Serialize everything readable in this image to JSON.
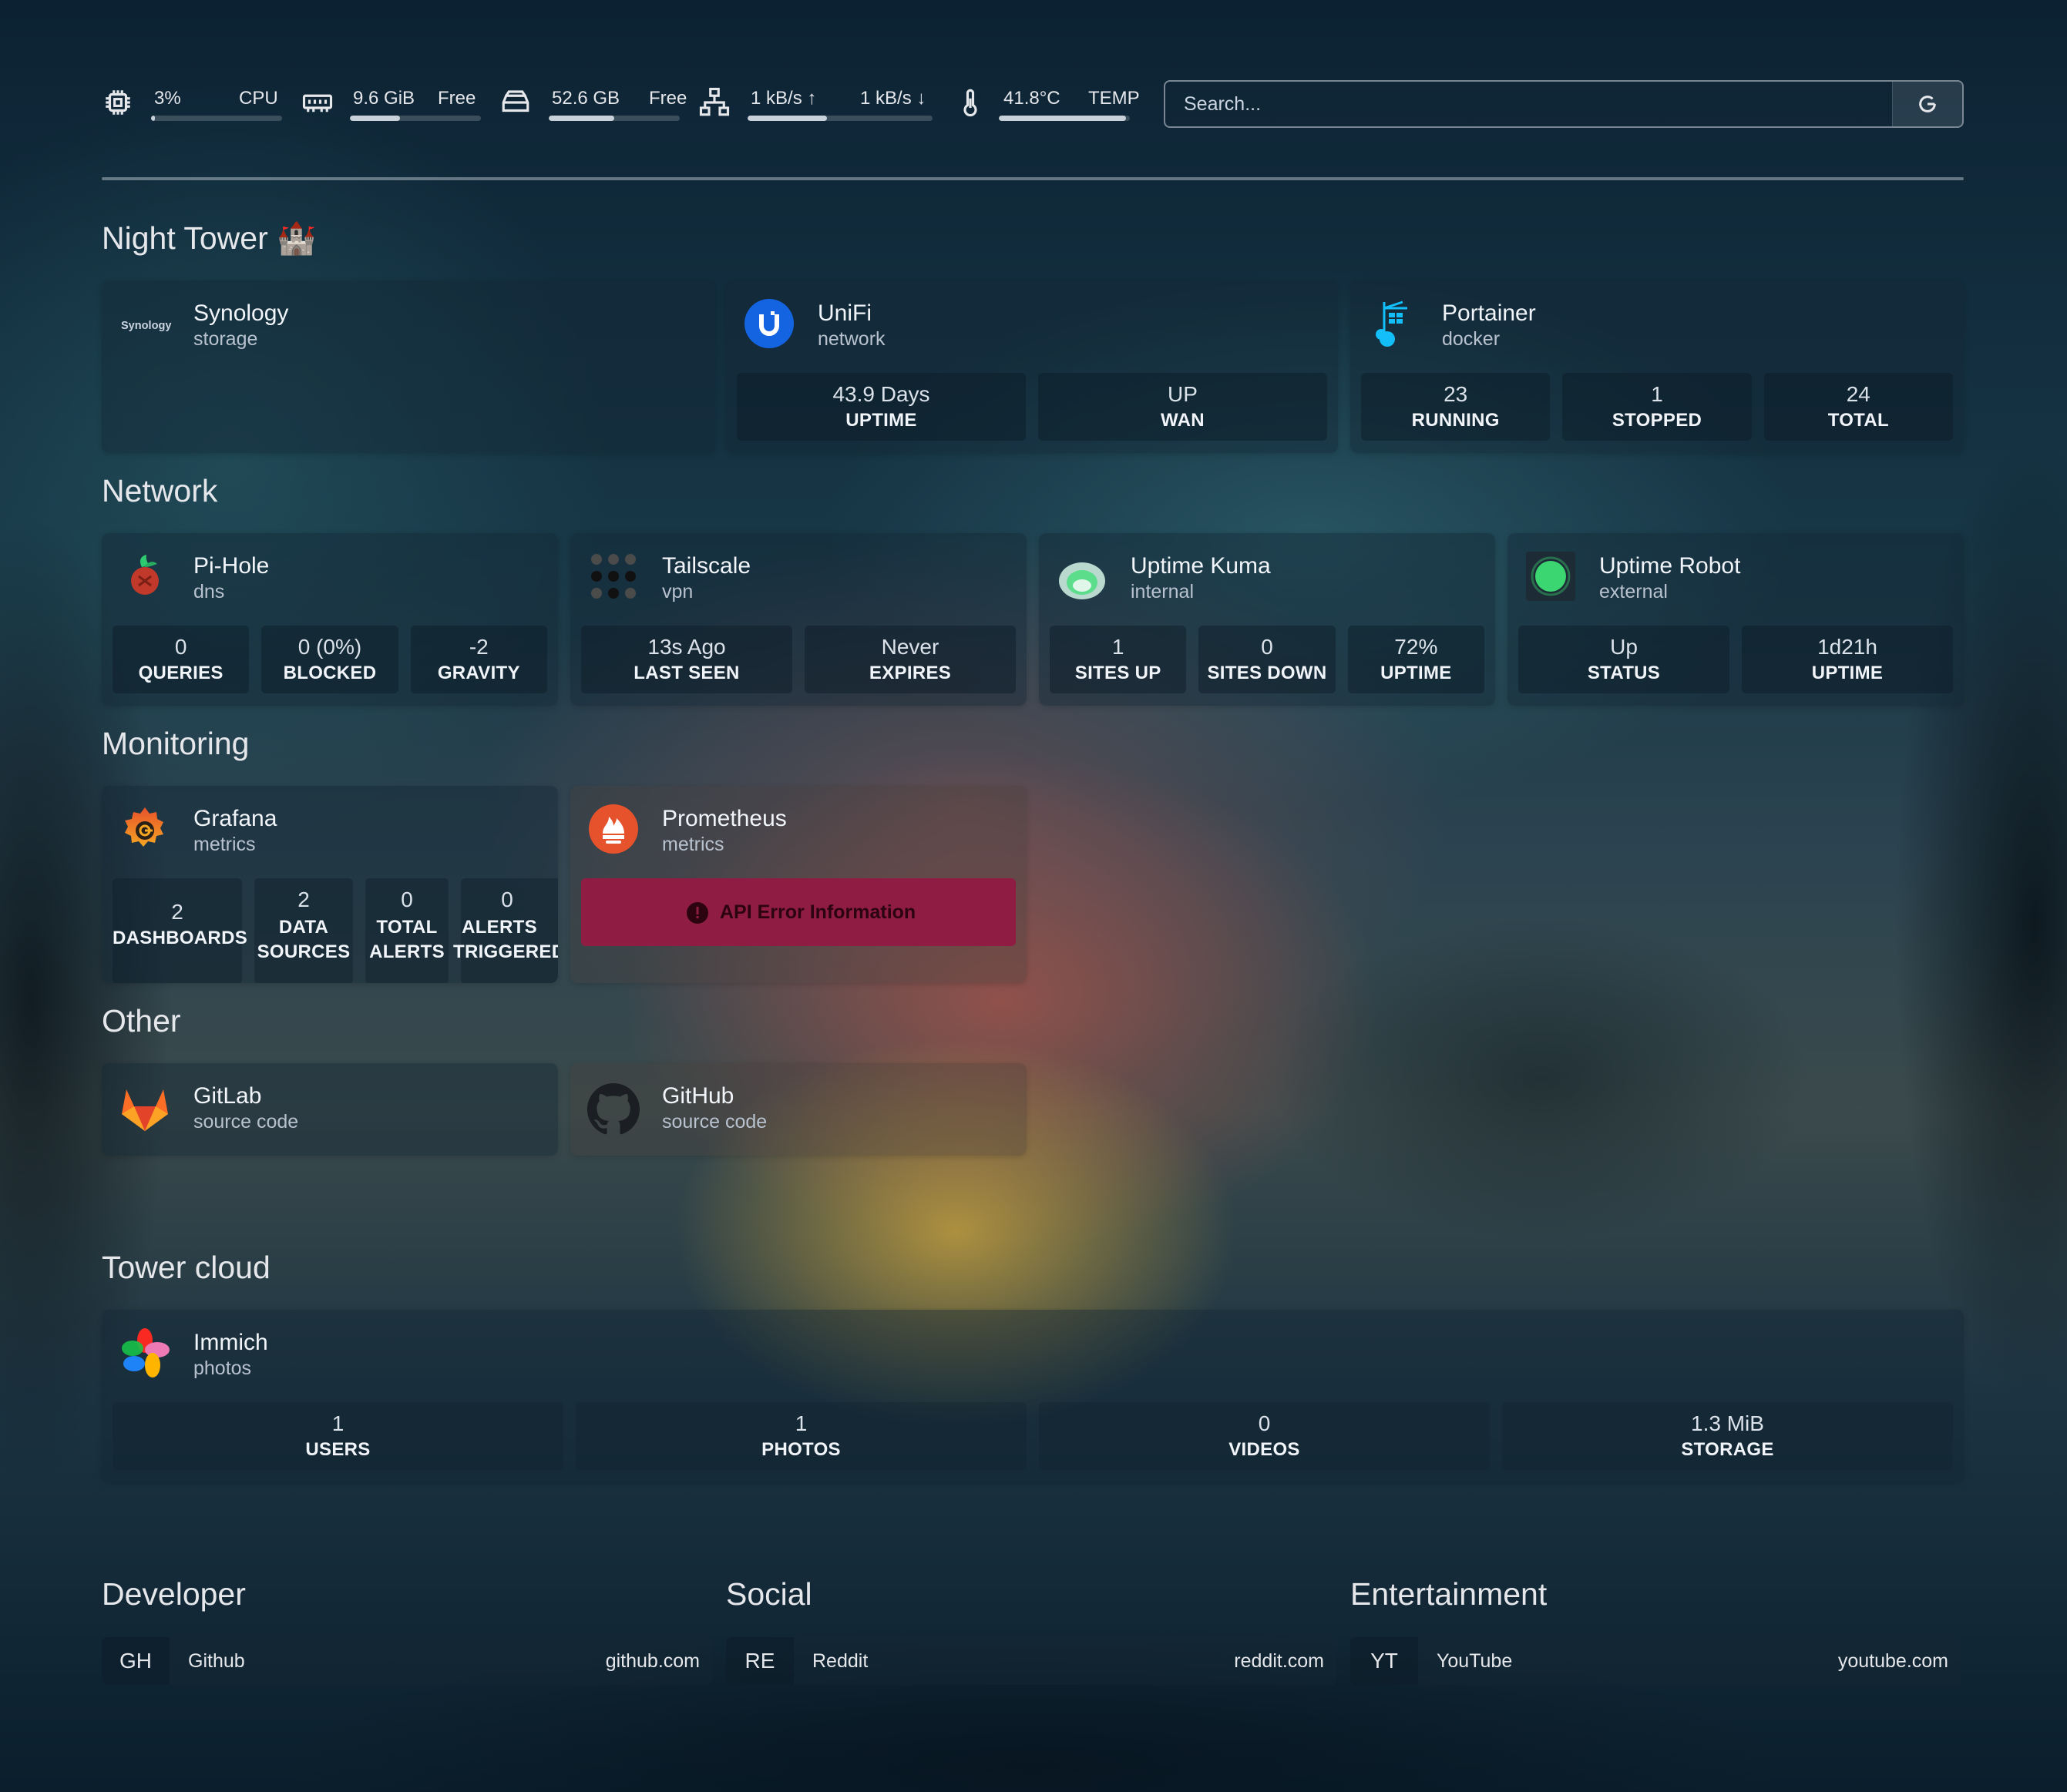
{
  "resources": {
    "cpu": {
      "value": "3%",
      "label": "CPU",
      "fill": 0.03
    },
    "memory": {
      "value": "9.6 GiB",
      "label": "Free",
      "fill": 0.38
    },
    "disk": {
      "value": "52.6 GB",
      "label": "Free",
      "fill": 0.5
    },
    "network": {
      "up": "1 kB/s ↑",
      "down": "1 kB/s ↓",
      "fill": 0.43
    },
    "temp": {
      "value": "41.8°C",
      "label": "TEMP",
      "fill": 0.97
    }
  },
  "search": {
    "placeholder": "Search..."
  },
  "groups": {
    "night_tower": {
      "title": "Night Tower 🏰",
      "services": [
        {
          "name": "Synology",
          "desc": "storage",
          "stats": []
        },
        {
          "name": "UniFi",
          "desc": "network",
          "stats": [
            {
              "value": "43.9 Days",
              "label": "UPTIME"
            },
            {
              "value": "UP",
              "label": "WAN"
            }
          ]
        },
        {
          "name": "Portainer",
          "desc": "docker",
          "stats": [
            {
              "value": "23",
              "label": "RUNNING"
            },
            {
              "value": "1",
              "label": "STOPPED"
            },
            {
              "value": "24",
              "label": "TOTAL"
            }
          ]
        }
      ]
    },
    "network": {
      "title": "Network",
      "services": [
        {
          "name": "Pi-Hole",
          "desc": "dns",
          "stats": [
            {
              "value": "0",
              "label": "QUERIES"
            },
            {
              "value": "0 (0%)",
              "label": "BLOCKED"
            },
            {
              "value": "-2",
              "label": "GRAVITY"
            }
          ]
        },
        {
          "name": "Tailscale",
          "desc": "vpn",
          "stats": [
            {
              "value": "13s Ago",
              "label": "LAST SEEN"
            },
            {
              "value": "Never",
              "label": "EXPIRES"
            }
          ]
        },
        {
          "name": "Uptime Kuma",
          "desc": "internal",
          "stats": [
            {
              "value": "1",
              "label": "SITES UP"
            },
            {
              "value": "0",
              "label": "SITES DOWN"
            },
            {
              "value": "72%",
              "label": "UPTIME"
            }
          ]
        },
        {
          "name": "Uptime Robot",
          "desc": "external",
          "stats": [
            {
              "value": "Up",
              "label": "STATUS"
            },
            {
              "value": "1d21h",
              "label": "UPTIME"
            }
          ]
        }
      ]
    },
    "monitoring": {
      "title": "Monitoring",
      "services": [
        {
          "name": "Grafana",
          "desc": "metrics",
          "stats": [
            {
              "value": "2",
              "label": "DASHBOARDS"
            },
            {
              "value": "2",
              "label": "DATA SOURCES"
            },
            {
              "value": "0",
              "label": "TOTAL ALERTS"
            },
            {
              "value": "0",
              "label": "ALERTS TRIGGERED"
            }
          ]
        },
        {
          "name": "Prometheus",
          "desc": "metrics",
          "error": "API Error Information"
        }
      ]
    },
    "other": {
      "title": "Other",
      "services": [
        {
          "name": "GitLab",
          "desc": "source code"
        },
        {
          "name": "GitHub",
          "desc": "source code"
        }
      ]
    },
    "tower_cloud": {
      "title": "Tower cloud",
      "services": [
        {
          "name": "Immich",
          "desc": "photos",
          "stats": [
            {
              "value": "1",
              "label": "USERS"
            },
            {
              "value": "1",
              "label": "PHOTOS"
            },
            {
              "value": "0",
              "label": "VIDEOS"
            },
            {
              "value": "1.3 MiB",
              "label": "STORAGE"
            }
          ]
        }
      ]
    }
  },
  "bookmarks": [
    {
      "title": "Developer",
      "abbr": "GH",
      "name": "Github",
      "url": "github.com"
    },
    {
      "title": "Social",
      "abbr": "RE",
      "name": "Reddit",
      "url": "reddit.com"
    },
    {
      "title": "Entertainment",
      "abbr": "YT",
      "name": "YouTube",
      "url": "youtube.com"
    }
  ],
  "icons": {
    "synology_logo_text": "Synology",
    "accent_error": "#8f1c43"
  }
}
